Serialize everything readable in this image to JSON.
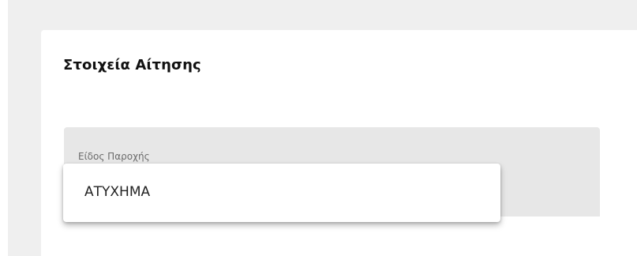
{
  "card": {
    "title": "Στοιχεία Αίτησης"
  },
  "service_type_field": {
    "label": "Είδος Παροχής",
    "options": [
      "ΑΤΥΧΗΜΑ"
    ]
  }
}
